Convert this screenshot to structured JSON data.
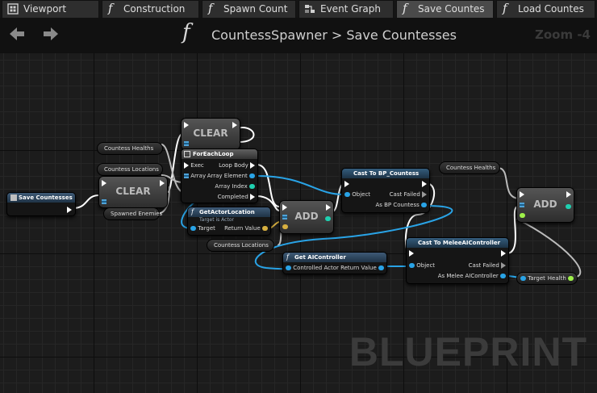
{
  "tabs": [
    {
      "label": "Viewport",
      "icon": "viewport-icon",
      "active": false
    },
    {
      "label": "Construction",
      "icon": "function-icon",
      "active": false
    },
    {
      "label": "Spawn Count",
      "icon": "function-icon",
      "active": false
    },
    {
      "label": "Event Graph",
      "icon": "event-graph-icon",
      "active": false
    },
    {
      "label": "Save Countes",
      "icon": "function-icon",
      "active": true
    },
    {
      "label": "Load Countes",
      "icon": "function-icon",
      "active": false
    }
  ],
  "breadcrumb": {
    "graph": "CountessSpawner",
    "separator": ">",
    "function": "Save Countesses",
    "zoom": "Zoom -4"
  },
  "watermark": "BLUEPRINT",
  "nodes": {
    "entry": {
      "title": "Save Countesses"
    },
    "clear_top": {
      "label": "CLEAR"
    },
    "clear_mid": {
      "label": "CLEAR"
    },
    "var_health": {
      "label": "Countess Healths"
    },
    "var_locations": {
      "label": "Countess Locations"
    },
    "var_spawned": {
      "label": "Spawned Enemies"
    },
    "foreach": {
      "title": "ForEachLoop",
      "exec": "Exec",
      "array": "Array",
      "loop_body": "Loop Body",
      "array_element": "Array Element",
      "array_index": "Array Index",
      "completed": "Completed"
    },
    "getactor": {
      "title": "GetActorLocation",
      "subtitle": "Target is Actor",
      "target": "Target",
      "return_value": "Return Value"
    },
    "var_locations2": {
      "label": "Countess Locations"
    },
    "add_mid": {
      "label": "ADD"
    },
    "getai": {
      "title": "Get AIController",
      "controlled_actor": "Controlled Actor",
      "return_value": "Return Value"
    },
    "cast_countess": {
      "title": "Cast To BP_Countess",
      "object": "Object",
      "cast_failed": "Cast Failed",
      "as_output": "As BP Countess"
    },
    "cast_melee": {
      "title": "Cast To MeleeAIController",
      "object": "Object",
      "cast_failed": "Cast Failed",
      "as_output": "As Melee AIController"
    },
    "var_health2": {
      "label": "Countess Healths"
    },
    "add_right": {
      "label": "ADD"
    },
    "health_getter": {
      "target": "Target",
      "health": "Health"
    }
  },
  "colors": {
    "exec_wire": "#ffffff",
    "object_wire": "#29a3e6",
    "struct_wire": "#d8b040",
    "array_wire": "#bbbbbb"
  }
}
